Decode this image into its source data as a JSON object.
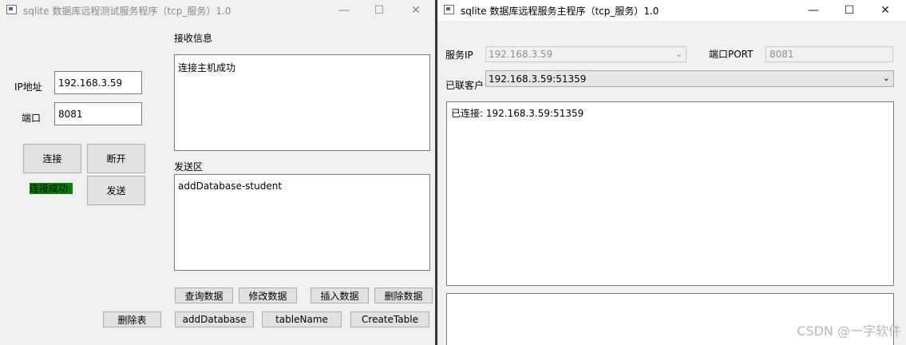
{
  "client_window": {
    "title": "sqlite 数据库远程测试服务程序（tcp_服务）1.0",
    "ip_label": "IP地址",
    "ip_value": "192.168.3.59",
    "port_label": "端口",
    "port_value": "8081",
    "connect_button": "连接",
    "disconnect_button": "断开",
    "send_button": "发送",
    "status_text": "连接成功",
    "receive_label": "接收信息",
    "receive_text": "连接主机成功",
    "send_area_label": "发送区",
    "send_text": "addDatabase-student",
    "query_button": "查询数据",
    "modify_button": "修改数据",
    "insert_button": "插入数据",
    "delete_button": "删除数据",
    "drop_table_button": "删除表",
    "add_database_button": "addDatabase",
    "table_name_button": "tableName",
    "create_table_button": "CreateTable"
  },
  "server_window": {
    "title": "sqlite 数据库远程服务主程序（tcp_服务）1.0",
    "service_ip_label": "服务IP",
    "service_ip_value": "192.168.3.59",
    "port_label": "端口PORT",
    "port_value": "8081",
    "connected_clients_label": "已联客户",
    "connected_client_value": "192.168.3.59:51359",
    "log_text": "已连接: 192.168.3.59:51359"
  },
  "window_controls": {
    "minimize": "—",
    "maximize": "☐",
    "close": "✕"
  },
  "watermark": "CSDN @一字软件",
  "colors": {
    "status_green": "#008000"
  }
}
